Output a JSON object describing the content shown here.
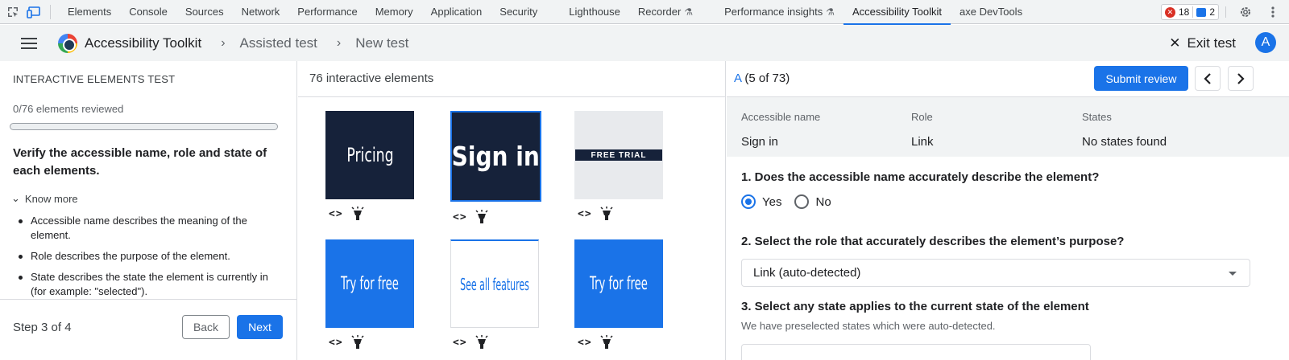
{
  "devtools": {
    "tabs": [
      {
        "label": "Elements"
      },
      {
        "label": "Console"
      },
      {
        "label": "Sources"
      },
      {
        "label": "Network"
      },
      {
        "label": "Performance"
      },
      {
        "label": "Memory"
      },
      {
        "label": "Application"
      },
      {
        "label": "Security"
      },
      {
        "label": "Lighthouse"
      },
      {
        "label": "Recorder",
        "experimental": true
      },
      {
        "label": "Performance insights",
        "experimental": true
      },
      {
        "label": "Accessibility Toolkit",
        "active": true
      },
      {
        "label": "axe DevTools"
      }
    ],
    "errors_count": "18",
    "messages_count": "2"
  },
  "header": {
    "app_title": "Accessibility Toolkit",
    "crumb1": "Assisted test",
    "crumb2": "New test",
    "exit_label": "Exit test",
    "avatar_letter": "A"
  },
  "left_panel": {
    "heading": "INTERACTIVE ELEMENTS TEST",
    "progress_text": "0/76 elements reviewed",
    "progress_value": 0,
    "prompt": "Verify the accessible name, role and state of each elements.",
    "know_more": "Know more",
    "bullets": [
      "Accessible name describes the meaning of the element.",
      "Role describes the purpose of the element.",
      "State describes the state the element is currently in (for example: \"selected\")."
    ],
    "step_text": "Step 3 of 4",
    "back_label": "Back",
    "next_label": "Next"
  },
  "middle_panel": {
    "heading": "76 interactive elements",
    "code_glyph": "<>",
    "thumbnails": [
      {
        "text": "Pricing",
        "style": "dark"
      },
      {
        "text": "Sign in",
        "style": "dark",
        "selected": true
      },
      {
        "text": "FREE TRIAL",
        "style": "grey"
      },
      {
        "text": "Try for free",
        "style": "blue"
      },
      {
        "text": "See all features",
        "style": "white"
      },
      {
        "text": "Try for free",
        "style": "blue"
      }
    ]
  },
  "right_panel": {
    "count_link": "A",
    "count_rest": "(5 of 73)",
    "submit_label": "Submit review",
    "table": {
      "headers": [
        "Accessible name",
        "Role",
        "States"
      ],
      "values": [
        "Sign in",
        "Link",
        "No states found"
      ]
    },
    "q1": "1. Does the accessible name accurately describe the element?",
    "yes_label": "Yes",
    "no_label": "No",
    "selected_answer": "Yes",
    "q2": "2. Select the role that accurately describes the element’s purpose?",
    "role_value": "Link (auto-detected)",
    "q3": "3. Select any state applies to the current state of the element",
    "q3_hint": "We have preselected states which were auto-detected."
  },
  "colors": {
    "accent": "#1a73e8",
    "thumb_dark": "#16223a",
    "panel_grey": "#f1f3f4"
  }
}
